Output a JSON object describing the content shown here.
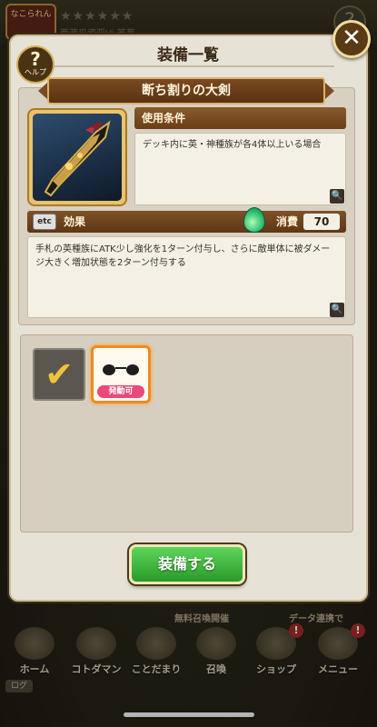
{
  "background": {
    "stars": "★★★★★★",
    "subtitle": "西蓝瓜瓷亚Vi 苦苺",
    "badge": "なこられん",
    "help_q": "?"
  },
  "dialog": {
    "title": "装備一覧",
    "help_label": "ヘルプ",
    "help_mark": "?",
    "close_mark": "✕",
    "item_name": "断ち割りの大剣",
    "condition_header": "使用条件",
    "condition_text": "デッキ内に英・神種族が各4体以上いる場合",
    "effect_tag": "etc",
    "effect_header": "効果",
    "cost_label": "消費",
    "cost_value": "70",
    "effect_text": "手札の英種族にATK少し強化を1ターン付与し、さらに敵単体に被ダメージ大きく増加状態を2ターン付与する",
    "magnify_icon": "🔍",
    "slot_check": "✔",
    "slot_activate_label": "発動可",
    "equip_button": "装備する"
  },
  "nav": {
    "free_summon": "無料召喚開催",
    "data_link": "データ連携で",
    "items": [
      {
        "label": "ホーム",
        "icon": "home-icon"
      },
      {
        "label": "コトダマン",
        "icon": "kotodaman-icon"
      },
      {
        "label": "ことだまり",
        "icon": "kotodamari-icon"
      },
      {
        "label": "召喚",
        "icon": "summon-icon"
      },
      {
        "label": "ショップ",
        "icon": "shop-icon"
      },
      {
        "label": "メニュー",
        "icon": "menu-icon"
      }
    ],
    "badge": "!",
    "log": "ログ"
  },
  "colors": {
    "panel": "#e7e2d6",
    "header_brown": "#6a3e18",
    "equip_green": "#2a9a2a",
    "slot_orange": "#f08a1e",
    "activate_pink": "#e84a7a"
  }
}
